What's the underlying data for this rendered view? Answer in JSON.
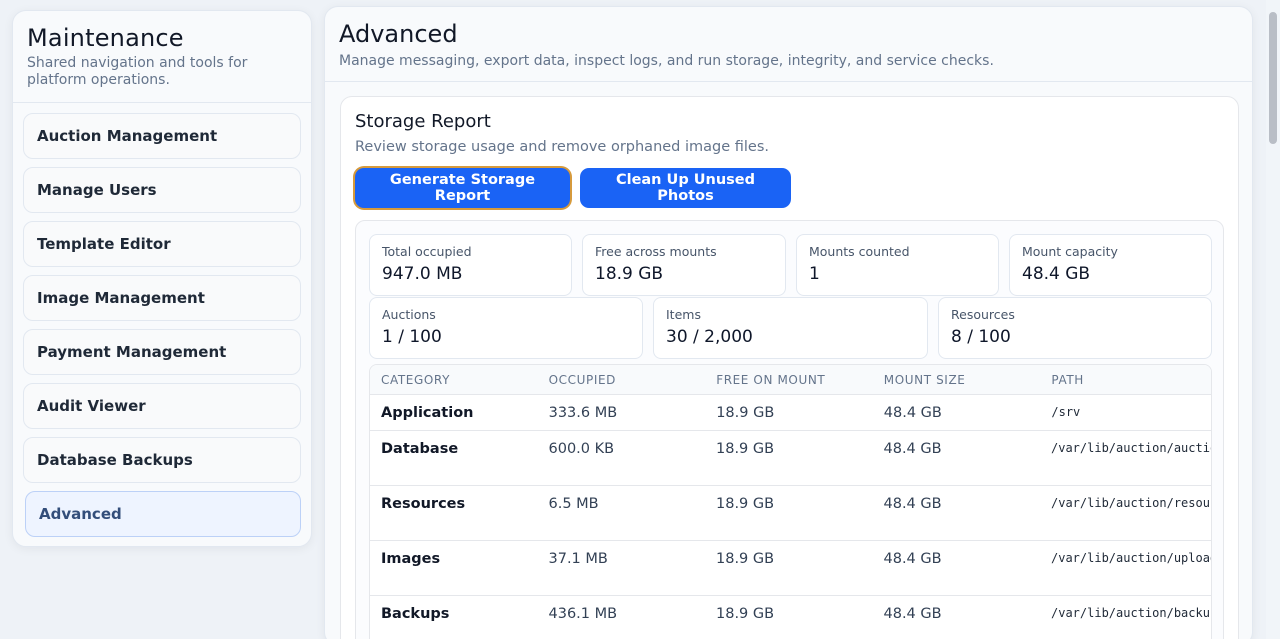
{
  "sidebar": {
    "title": "Maintenance",
    "subtitle": "Shared navigation and tools for platform operations.",
    "items": [
      {
        "label": "Auction Management"
      },
      {
        "label": "Manage Users"
      },
      {
        "label": "Template Editor"
      },
      {
        "label": "Image Management"
      },
      {
        "label": "Payment Management"
      },
      {
        "label": "Audit Viewer"
      },
      {
        "label": "Database Backups"
      },
      {
        "label": "Advanced",
        "active": true
      }
    ]
  },
  "main": {
    "title": "Advanced",
    "subtitle": "Manage messaging, export data, inspect logs, and run storage, integrity, and service checks."
  },
  "storage": {
    "title": "Storage Report",
    "description": "Review storage usage and remove orphaned image files.",
    "generate_label": "Generate Storage Report",
    "cleanup_label": "Clean Up Unused Photos",
    "stats": [
      {
        "label": "Total occupied",
        "value": "947.0 MB"
      },
      {
        "label": "Free across mounts",
        "value": "18.9 GB"
      },
      {
        "label": "Mounts counted",
        "value": "1"
      },
      {
        "label": "Mount capacity",
        "value": "48.4 GB"
      },
      {
        "label": "Auctions",
        "value": "1 / 100"
      },
      {
        "label": "Items",
        "value": "30 / 2,000"
      },
      {
        "label": "Resources",
        "value": "8 / 100"
      }
    ],
    "table": {
      "headers": [
        "CATEGORY",
        "OCCUPIED",
        "FREE ON MOUNT",
        "MOUNT SIZE",
        "PATH"
      ],
      "rows": [
        {
          "category": "Application",
          "occupied": "333.6 MB",
          "free": "18.9 GB",
          "size": "48.4 GB",
          "path": "/srv"
        },
        {
          "category": "Database",
          "occupied": "600.0 KB",
          "free": "18.9 GB",
          "size": "48.4 GB",
          "path": "/var/lib/auction/auction.db"
        },
        {
          "category": "Resources",
          "occupied": "6.5 MB",
          "free": "18.9 GB",
          "size": "48.4 GB",
          "path": "/var/lib/auction/resources"
        },
        {
          "category": "Images",
          "occupied": "37.1 MB",
          "free": "18.9 GB",
          "size": "48.4 GB",
          "path": "/var/lib/auction/uploads"
        },
        {
          "category": "Backups",
          "occupied": "436.1 MB",
          "free": "18.9 GB",
          "size": "48.4 GB",
          "path": "/var/lib/auction/backup"
        }
      ]
    }
  }
}
